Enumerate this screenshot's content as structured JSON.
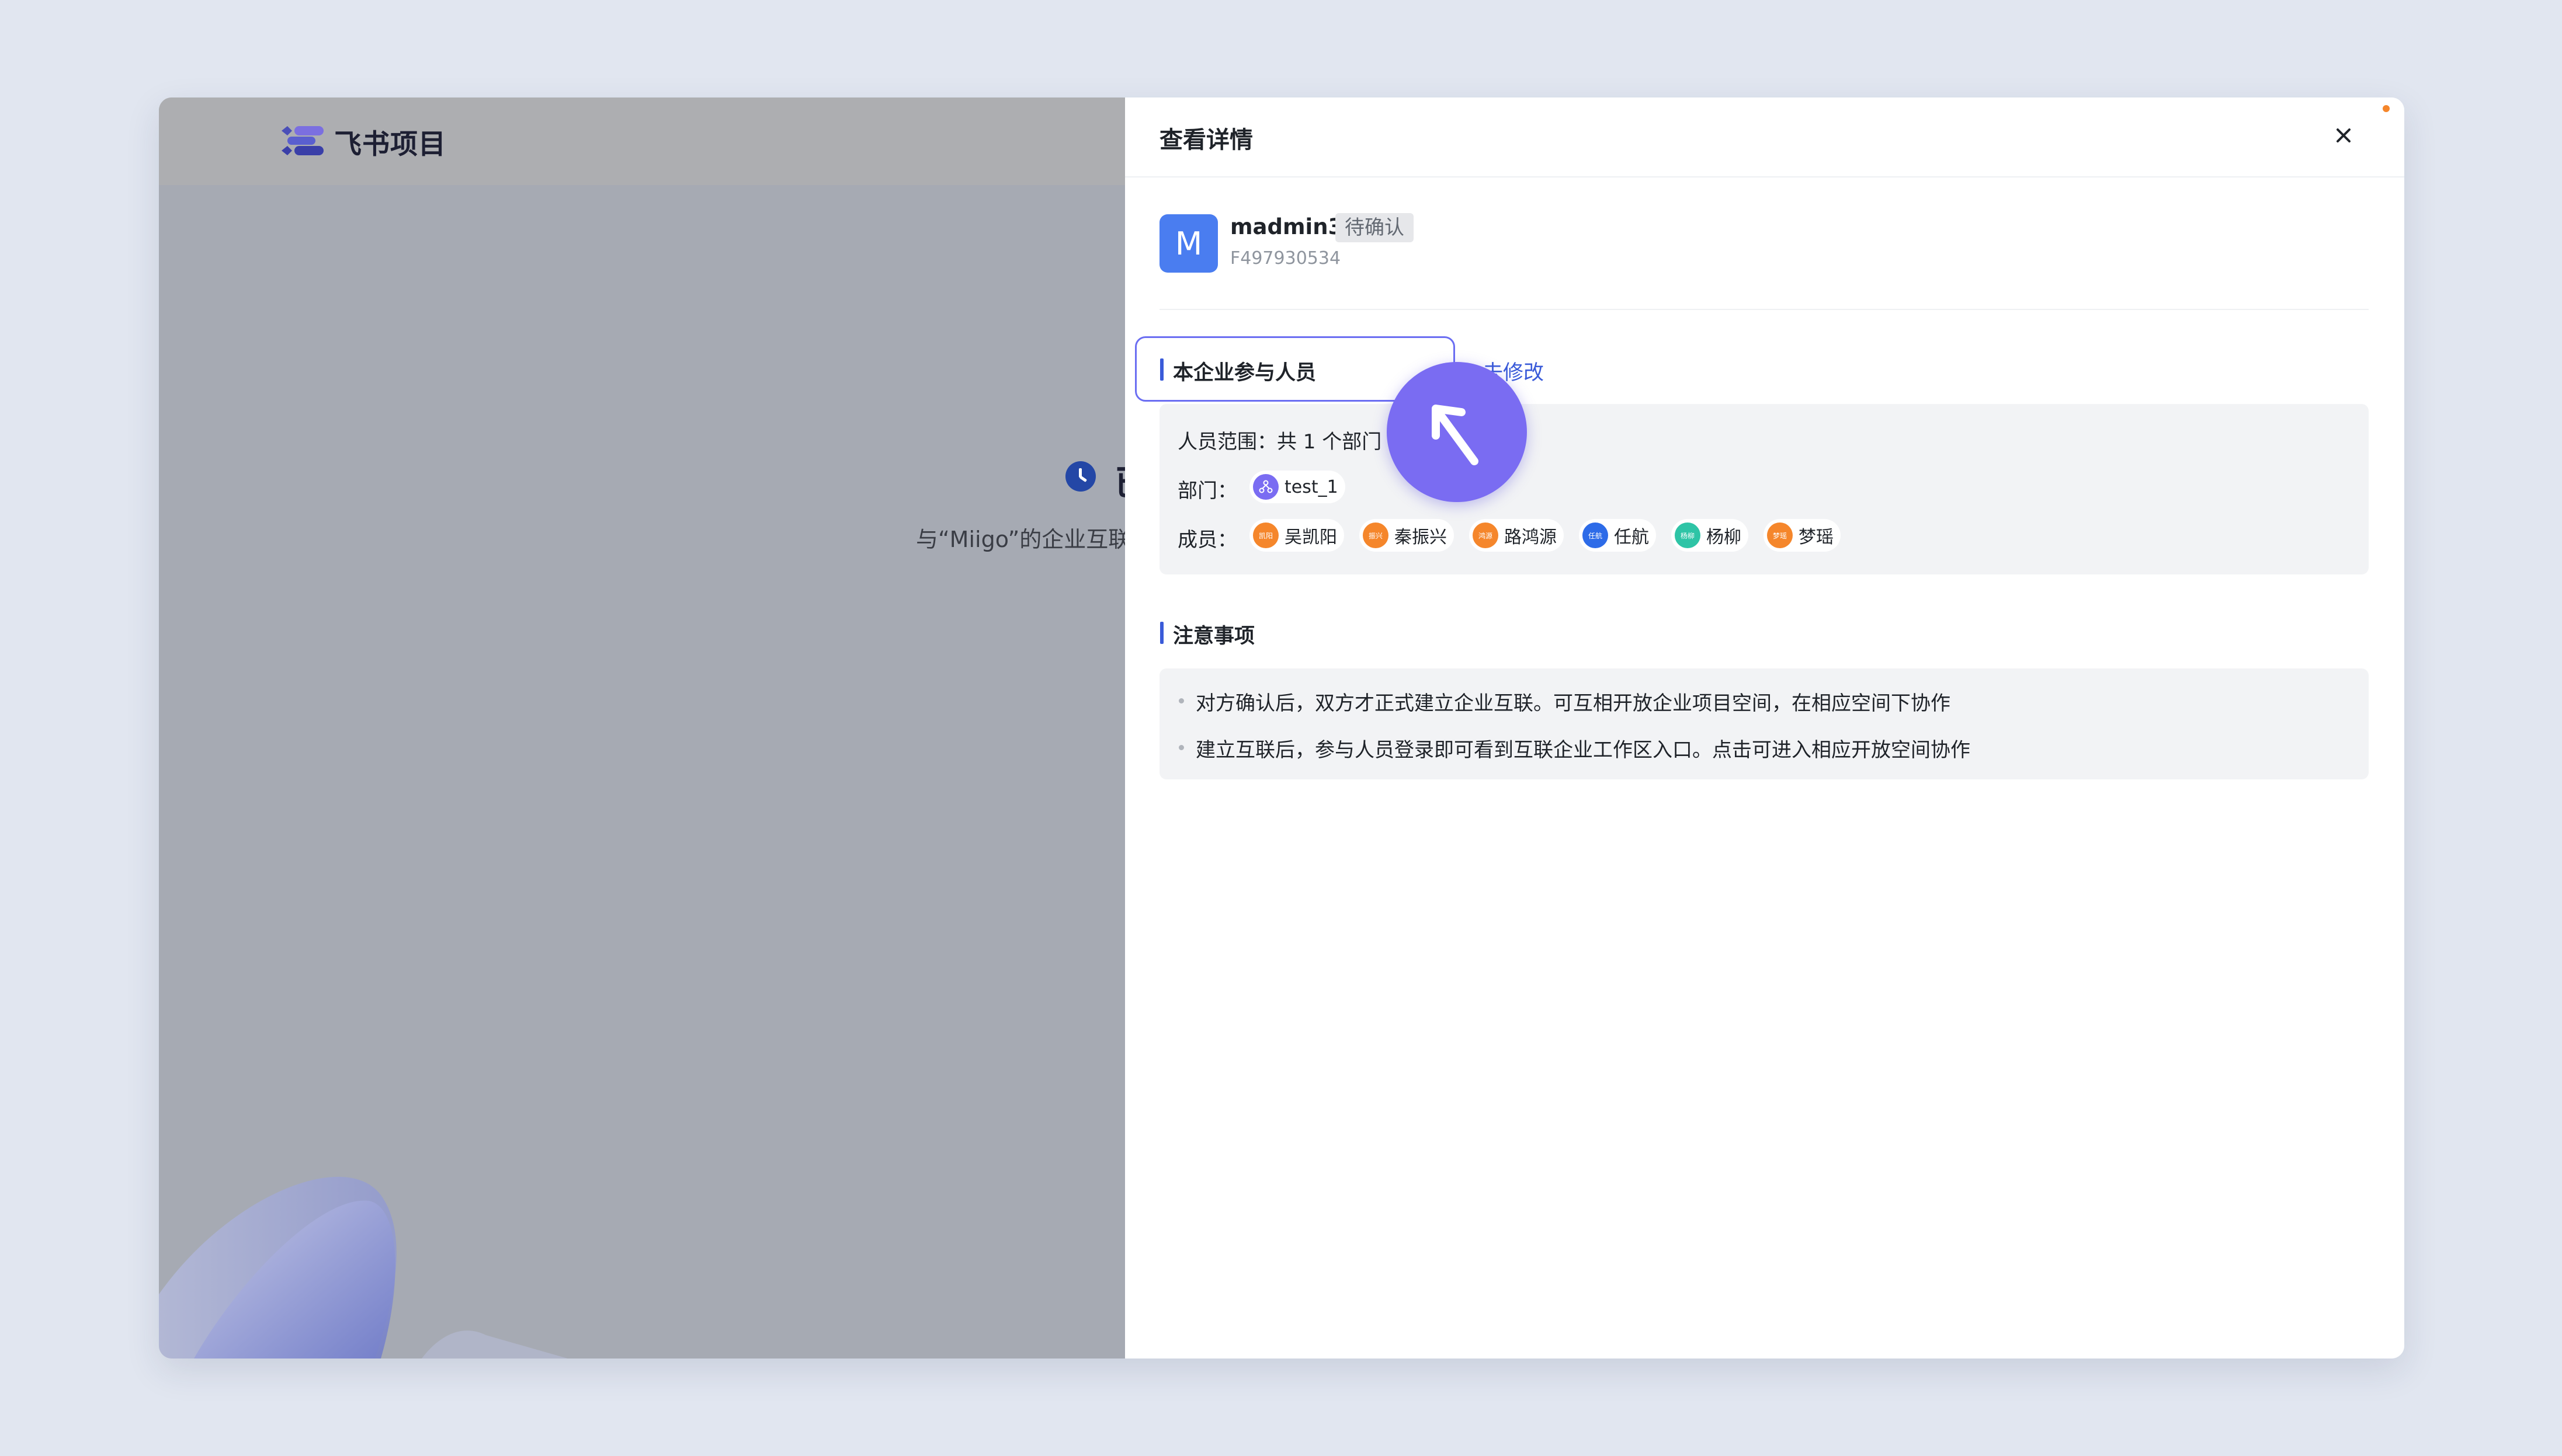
{
  "app": {
    "logo_text": "飞书项目",
    "left_heading_char": "已",
    "left_subtitle": "与“Miigo”的企业互联"
  },
  "panel": {
    "title": "查看详情",
    "close_icon": "close-icon"
  },
  "user": {
    "avatar_letter": "M",
    "name": "madmin3",
    "status": "待确认",
    "id": "F497930534"
  },
  "participants": {
    "title": "本企业参与人员",
    "edit_link": "去修改",
    "scope_label": "人员范围：共 1 个部门",
    "department_label": "部门：",
    "departments": [
      {
        "name": "test_1",
        "icon": "department-icon",
        "color": "#7a6cf2"
      }
    ],
    "members_label": "成员：",
    "members": [
      {
        "name": "吴凯阳",
        "initials": "凯阳",
        "color": "#f5862b"
      },
      {
        "name": "秦振兴",
        "initials": "振兴",
        "color": "#f5862b"
      },
      {
        "name": "路鸿源",
        "initials": "鸿源",
        "color": "#f5862b"
      },
      {
        "name": "任航",
        "initials": "任航",
        "color": "#2d6be8"
      },
      {
        "name": "杨柳",
        "initials": "杨柳",
        "color": "#2ec4a6"
      },
      {
        "name": "梦瑶",
        "initials": "梦瑶",
        "color": "#f5862b"
      }
    ]
  },
  "notes": {
    "title": "注意事项",
    "items": [
      "对方确认后，双方才正式建立企业互联。可互相开放企业项目空间，在相应空间下协作",
      "建立互联后，参与人员登录即可看到互联企业工作区入口。点击可进入相应开放空间协作"
    ]
  },
  "colors": {
    "accent": "#3a5bd9",
    "highlight_border": "#6b6ef2",
    "cursor": "#7a6cf2",
    "avatar": "#4a7df0"
  }
}
